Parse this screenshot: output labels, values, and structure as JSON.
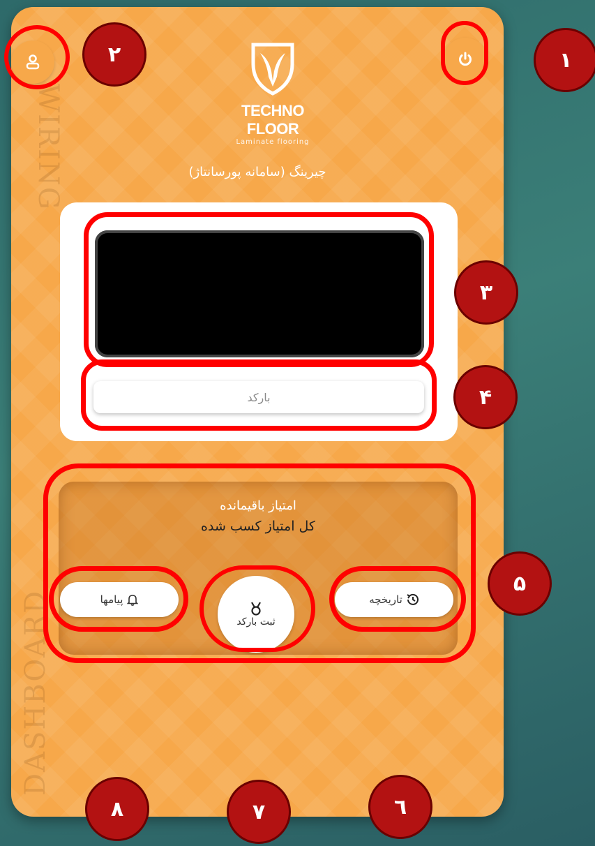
{
  "app": {
    "brand": "TECHNO FLOOR",
    "brand_sub": "Laminate flooring",
    "title": "چیرینگ (سامانه پورسانتاژ)",
    "side_text_top": "WIRING",
    "side_text_bottom": "DASHBOARD"
  },
  "header": {
    "power_icon": "power-icon",
    "user_icon": "user-icon"
  },
  "scanner": {
    "barcode_placeholder": "بارکد"
  },
  "scores": {
    "remaining_label": "امتیاز باقیمانده",
    "total_label": "کل امتیاز کسب شده"
  },
  "bottom_nav": {
    "messages_label": "پیامها",
    "register_label": "ثبت بارکد",
    "history_label": "تاریخچه"
  },
  "badges": {
    "b1": "۱",
    "b2": "۲",
    "b3": "۳",
    "b4": "۴",
    "b5": "۵",
    "b6": "٦",
    "b7": "۷",
    "b8": "۸"
  },
  "colors": {
    "panel_orange": "#f7a84a",
    "highlight_red": "#ff0000",
    "badge_red": "#b31212",
    "background_teal": "#3b7f78"
  }
}
